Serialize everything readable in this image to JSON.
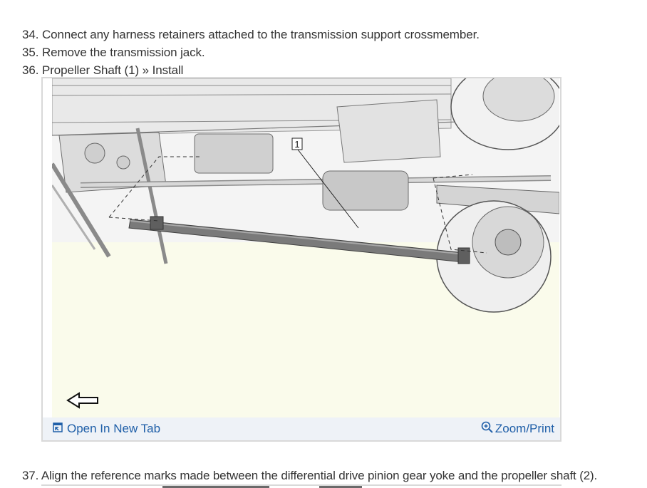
{
  "steps": [
    {
      "num": "34.",
      "text": "Connect any harness retainers attached to the transmission support crossmember."
    },
    {
      "num": "35.",
      "text": "Remove the transmission jack."
    },
    {
      "num": "36.",
      "text": "Propeller Shaft (1) » Install"
    }
  ],
  "figure": {
    "callout_label": "1",
    "open_tab_label": "Open In New Tab",
    "zoom_label": "Zoom/Print",
    "link_color": "#1f5fa8",
    "footer_bg": "#eef2f7",
    "image_bg": "#fafbeb"
  },
  "step37": {
    "num": "37.",
    "text": "Align the reference marks made between the differential drive pinion gear yoke and the propeller shaft (2)."
  },
  "icons": {
    "open_tab": "open-in-new-tab-icon",
    "zoom": "zoom-in-icon",
    "arrow": "front-direction-arrow-icon"
  }
}
